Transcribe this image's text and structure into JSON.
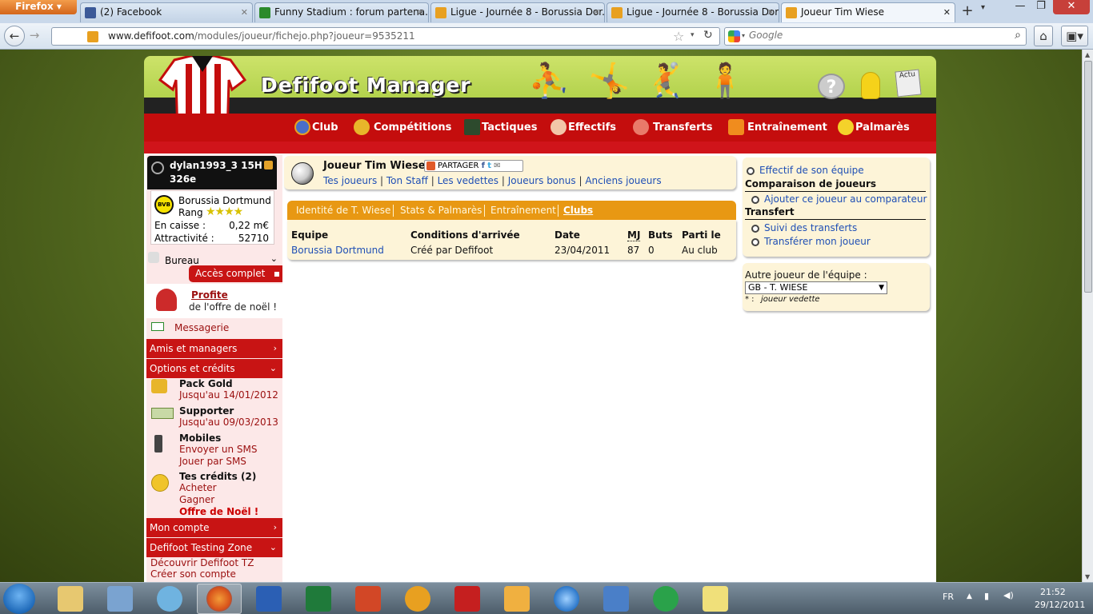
{
  "browser": {
    "menu_label": "Firefox",
    "tabs": [
      {
        "title": "(2) Facebook",
        "icon": "facebook-icon",
        "color": "#3b5998"
      },
      {
        "title": "Funny Stadium : forum partena...",
        "icon": "funny-stadium-icon",
        "color": "#2b8a2b"
      },
      {
        "title": "Ligue - Journée 8 - Borussia Dor...",
        "icon": "defifoot-icon",
        "color": "#e8a020"
      },
      {
        "title": "Ligue - Journée 8 - Borussia Dor...",
        "icon": "defifoot-icon",
        "color": "#e8a020"
      },
      {
        "title": "Joueur Tim Wiese",
        "icon": "defifoot-icon",
        "color": "#e8a020"
      }
    ],
    "url_domain": "www.defifoot.com",
    "url_path": "/modules/joueur/fichejo.php?joueur=9535211",
    "search_placeholder": "Google"
  },
  "site": {
    "title": "Defifoot Manager",
    "actu_label": "Actu",
    "nav": [
      {
        "label": "Club",
        "icon": "club-icon"
      },
      {
        "label": "Compétitions",
        "icon": "trophy-icon"
      },
      {
        "label": "Tactiques",
        "icon": "tactics-board-icon"
      },
      {
        "label": "Effectifs",
        "icon": "squad-icon"
      },
      {
        "label": "Transferts",
        "icon": "transfer-icon"
      },
      {
        "label": "Entraînement",
        "icon": "cone-icon"
      },
      {
        "label": "Palmarès",
        "icon": "medal-icon"
      }
    ]
  },
  "sidebar": {
    "user_name": "dylan1993_3 15H",
    "user_rank": "326e",
    "club_name": "Borussia Dortmund",
    "rang_label": "Rang",
    "stars": 4,
    "stars_text": "★★★★",
    "cash_label": "En caisse :",
    "cash_value": "0,22 m€",
    "attract_label": "Attractivité :",
    "attract_value": "52710",
    "bureau": "Bureau",
    "acces_complet": "Accès complet",
    "profite": "Profite",
    "offre_noel_line": "de l'offre de noël !",
    "messagerie": "Messagerie",
    "amis": "Amis et managers",
    "options": "Options et crédits",
    "pack_gold": "Pack Gold",
    "pack_gold_until": "Jusqu'au 14/01/2012",
    "supporter": "Supporter",
    "supporter_until": "Jusqu'au 09/03/2013",
    "mobiles": "Mobiles",
    "envoyer_sms": "Envoyer un SMS",
    "jouer_sms": "Jouer par SMS",
    "credits": "Tes crédits (2)",
    "acheter": "Acheter",
    "gagner": "Gagner",
    "offre_noel": "Offre de Noël !",
    "mon_compte": "Mon compte",
    "testing_zone": "Defifoot Testing Zone",
    "decouvrir": "Découvrir Defifoot TZ",
    "creer": "Créer son compte"
  },
  "player": {
    "title": "Joueur Tim Wiese",
    "share_label": "PARTAGER",
    "links": [
      "Tes joueurs",
      "Ton Staff",
      "Les vedettes",
      "Joueurs bonus",
      "Anciens joueurs"
    ],
    "tabs": [
      "Identité de T. Wiese",
      "Stats & Palmarès",
      "Entraînement",
      "Clubs"
    ],
    "active_tab": "Clubs",
    "table": {
      "headers": [
        "Equipe",
        "Conditions d'arrivée",
        "Date",
        "MJ",
        "Buts",
        "Parti le"
      ],
      "rows": [
        [
          "Borussia Dortmund",
          "Créé par Defifoot",
          "23/04/2011",
          "87",
          "0",
          "Au club"
        ]
      ]
    }
  },
  "right_panel": {
    "effectif": "Effectif de son équipe",
    "comparaison_title": "Comparaison de joueurs",
    "ajouter": "Ajouter ce joueur au comparateur",
    "transfert_title": "Transfert",
    "suivi": "Suivi des transferts",
    "transferer": "Transférer mon joueur",
    "autre_label": "Autre joueur de l'équipe :",
    "select_value": "GB - T. WIESE",
    "vedette_note_star": "* :",
    "vedette_note": "joueur vedette"
  },
  "taskbar": {
    "lang": "FR",
    "time": "21:52",
    "date": "29/12/2011"
  }
}
